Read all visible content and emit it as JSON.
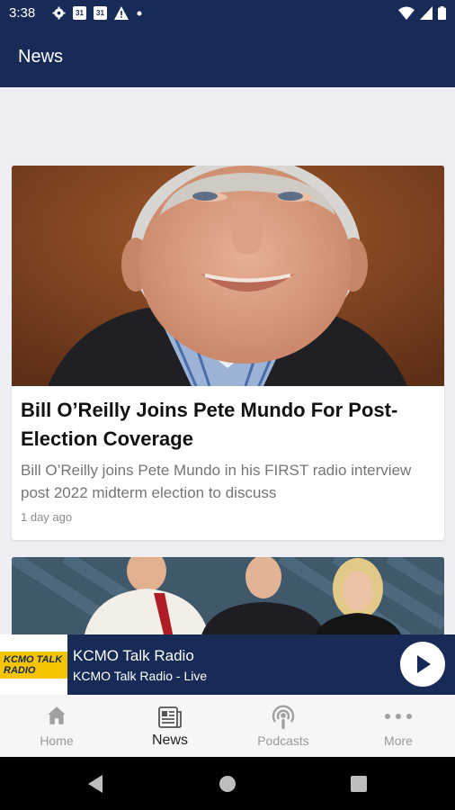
{
  "status_bar": {
    "time": "3:38",
    "calendar_day": "31"
  },
  "app_bar": {
    "title": "News"
  },
  "articles": [
    {
      "title": "Bill O’Reilly Joins Pete Mundo For Post-Election Coverage",
      "description": "Bill O’Reilly joins Pete Mundo in his FIRST radio interview post 2022 midterm election to discuss",
      "time": "1 day ago"
    }
  ],
  "player": {
    "logo_text": "KCMO TALK RADIO",
    "station_name": "KCMO Talk Radio",
    "subtitle": "KCMO Talk Radio - Live",
    "button_icon": "play-icon"
  },
  "bottom_nav": [
    {
      "label": "Home",
      "icon": "home-icon",
      "active": false
    },
    {
      "label": "News",
      "icon": "news-icon",
      "active": true
    },
    {
      "label": "Podcasts",
      "icon": "podcast-icon",
      "active": false
    },
    {
      "label": "More",
      "icon": "more-icon",
      "active": false
    }
  ],
  "colors": {
    "brand": "#182a56",
    "background": "#eeeff4",
    "logo_yellow": "#f4c400"
  }
}
